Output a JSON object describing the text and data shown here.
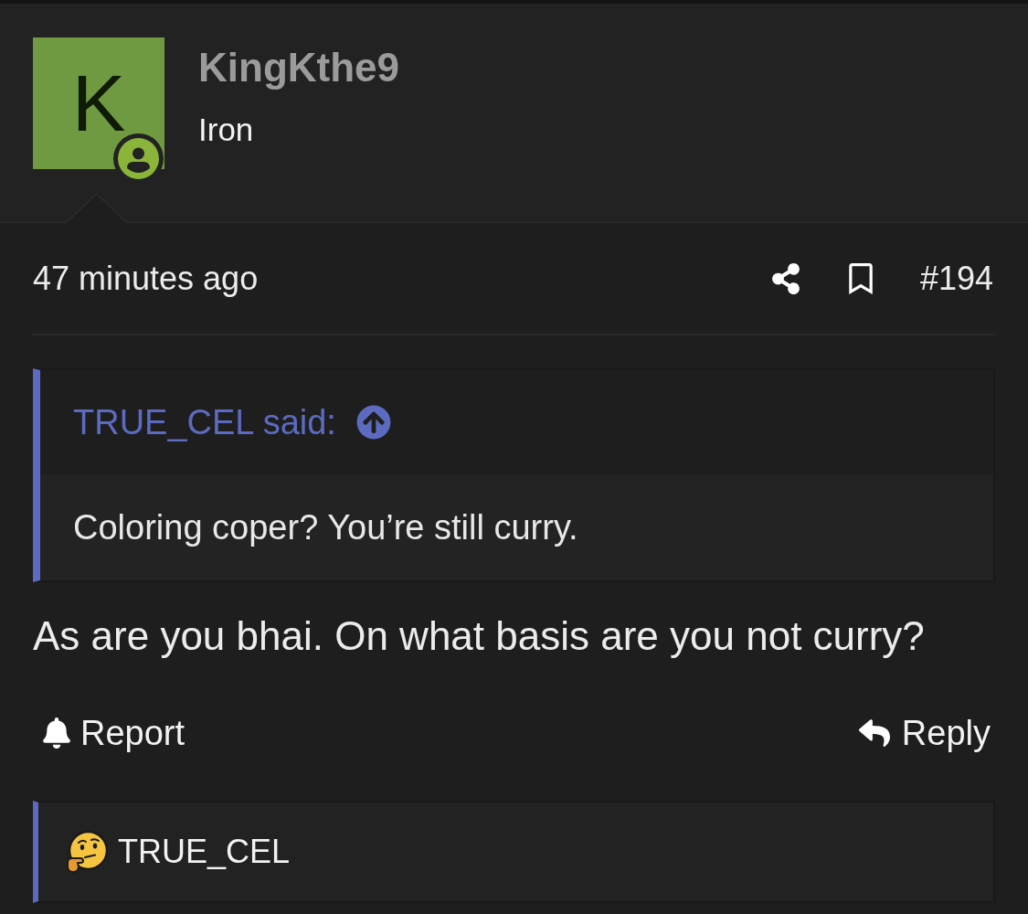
{
  "author": {
    "initial": "K",
    "name": "KingKthe9",
    "title": "Iron",
    "online": true
  },
  "post": {
    "time": "47 minutes ago",
    "number": "#194"
  },
  "quote": {
    "attribution": "TRUE_CEL said:",
    "text": "Coloring coper? You’re still curry."
  },
  "message": "As are you bhai. On what basis are you not curry?",
  "actions": [
    {
      "kind": "report",
      "label": "Report"
    },
    {
      "kind": "reply",
      "label": "Reply"
    }
  ],
  "reactions": {
    "users": "TRUE_CEL"
  }
}
